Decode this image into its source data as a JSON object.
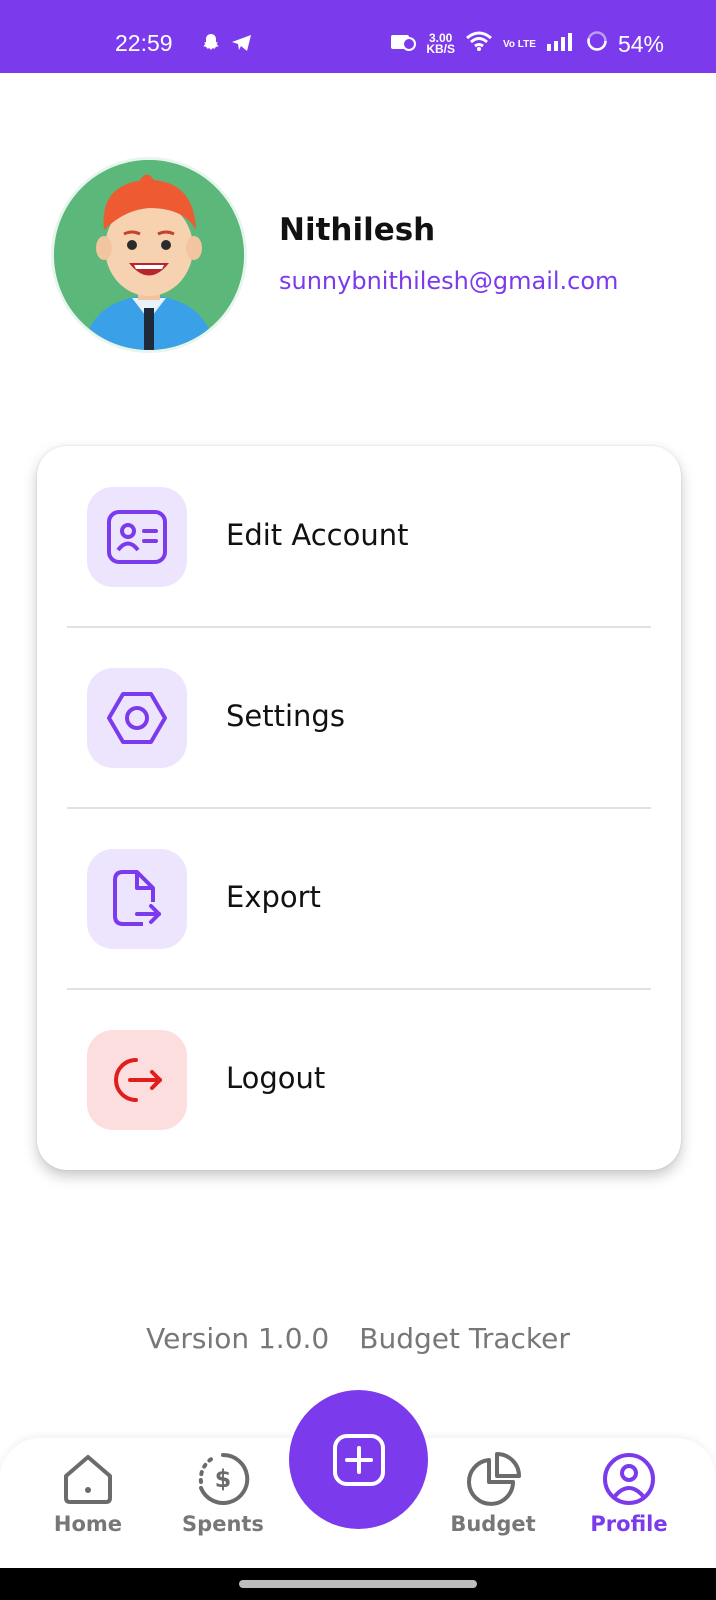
{
  "status_bar": {
    "time": "22:59",
    "net_speed": "3.00",
    "net_unit": "KB/S",
    "volte": "Vo LTE",
    "battery": "54%"
  },
  "profile": {
    "name": "Nithilesh",
    "email": "sunnybnithilesh@gmail.com",
    "avatar_icon": "cartoon-boy-avatar"
  },
  "menu": {
    "items": [
      {
        "label": "Edit Account",
        "icon": "id-card-icon"
      },
      {
        "label": "Settings",
        "icon": "hexagon-gear-icon"
      },
      {
        "label": "Export",
        "icon": "file-export-icon"
      },
      {
        "label": "Logout",
        "icon": "logout-icon"
      }
    ]
  },
  "footer": {
    "version": "Version 1.0.0",
    "app_name": "Budget Tracker"
  },
  "nav": {
    "items": [
      {
        "label": "Home",
        "icon": "home-icon"
      },
      {
        "label": "Spents",
        "icon": "dollar-cycle-icon"
      },
      {
        "label": "Budget",
        "icon": "pie-chart-icon"
      },
      {
        "label": "Profile",
        "icon": "user-circle-icon",
        "active": true
      }
    ],
    "fab_icon": "plus-square-icon"
  },
  "colors": {
    "accent": "#7c3aed",
    "icon_bg_purple": "#ede5fd",
    "logout": "#e11d1d",
    "logout_bg": "#fddede"
  }
}
